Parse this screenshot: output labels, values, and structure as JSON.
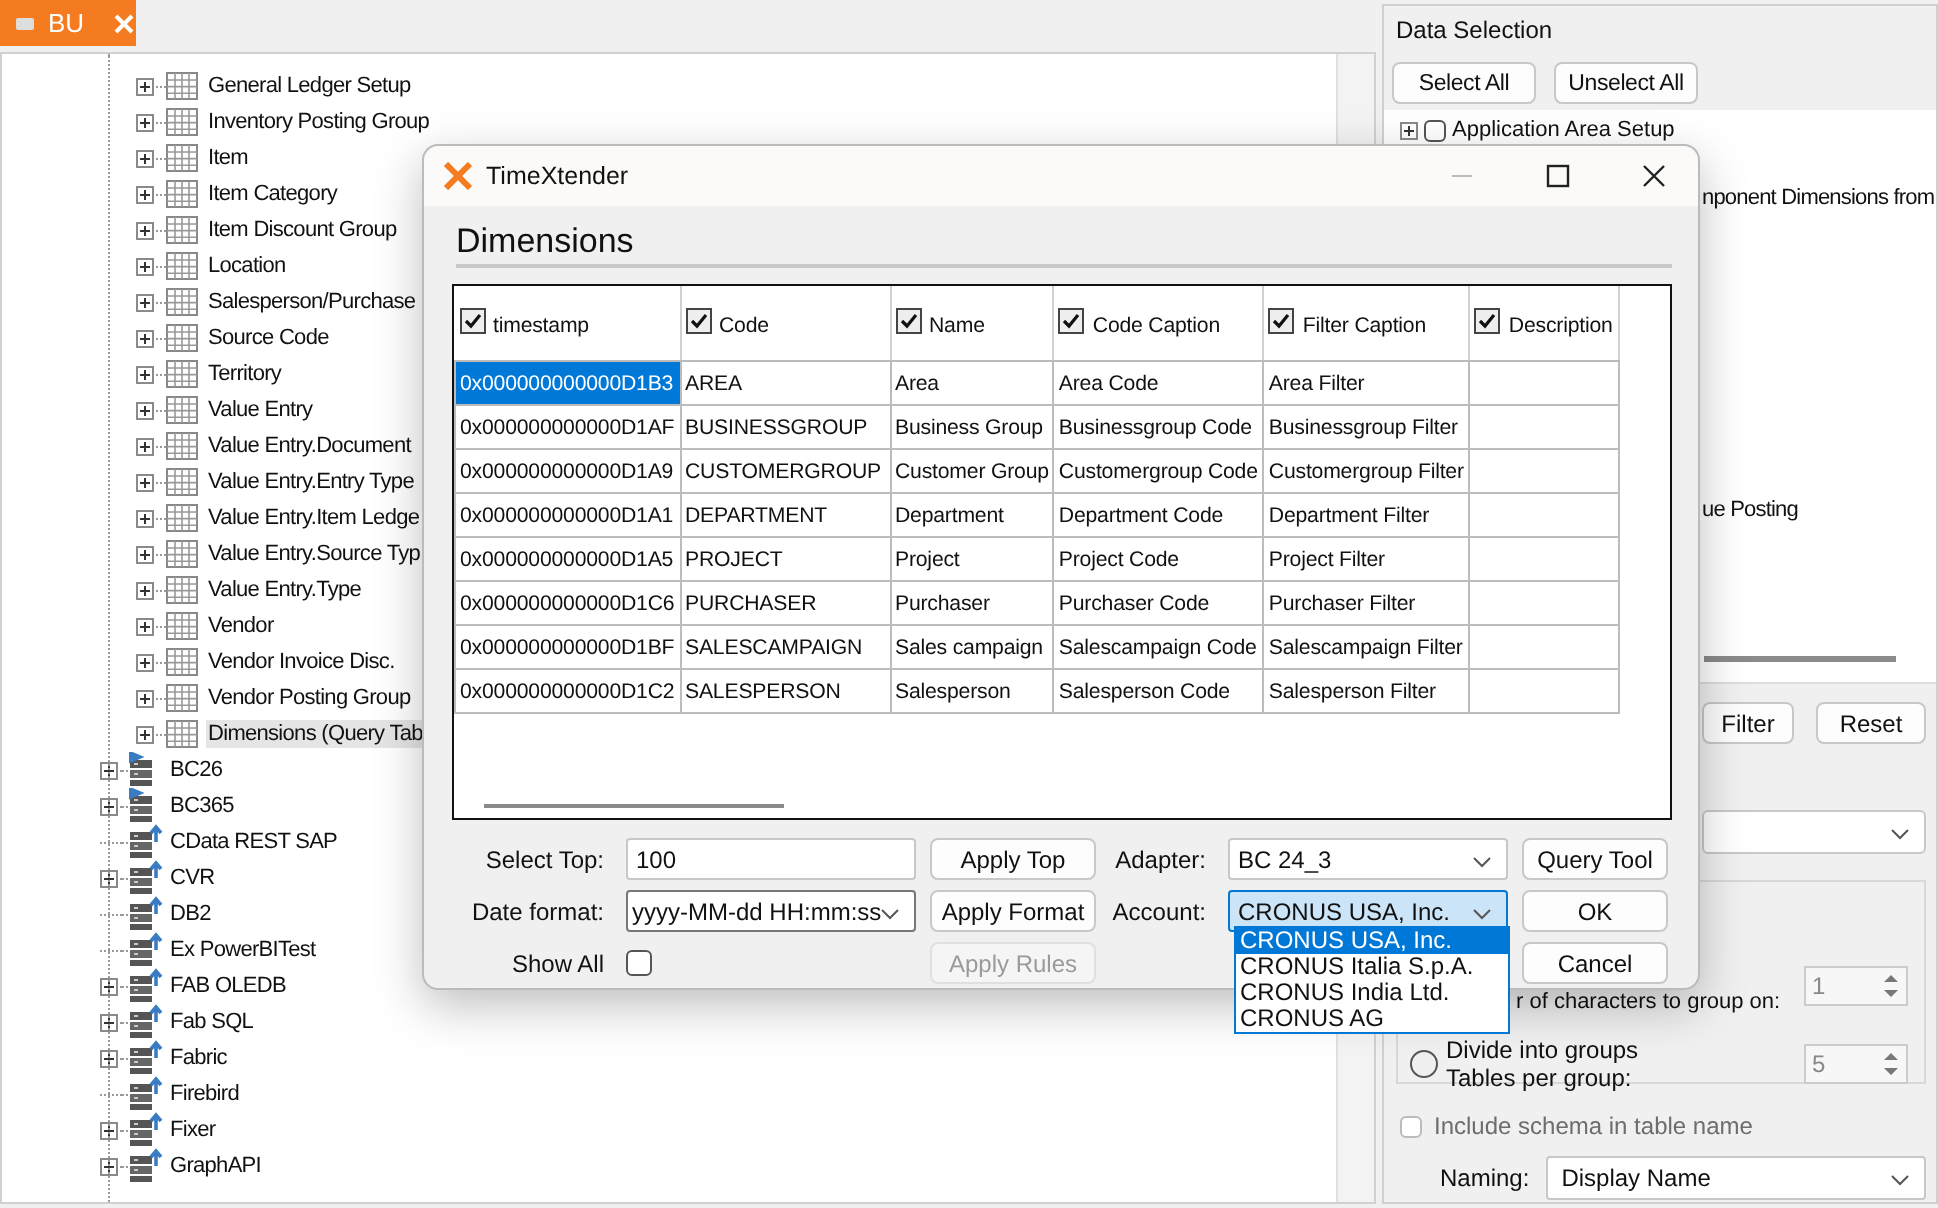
{
  "tab": {
    "label": "BU"
  },
  "tree": {
    "items": [
      {
        "children": [
          {
            "label": "General Ledger Setup",
            "selected": false
          },
          {
            "label": "Inventory Posting Group",
            "selected": false
          },
          {
            "label": "Item",
            "selected": false
          },
          {
            "label": "Item Category",
            "selected": false
          },
          {
            "label": "Item Discount Group",
            "selected": false
          },
          {
            "label": "Location",
            "selected": false
          },
          {
            "label": "Salesperson/Purchase",
            "selected": false
          },
          {
            "label": "Source Code",
            "selected": false
          },
          {
            "label": "Territory",
            "selected": false
          },
          {
            "label": "Value Entry",
            "selected": false
          },
          {
            "label": "Value Entry.Document",
            "selected": false
          },
          {
            "label": "Value Entry.Entry Type",
            "selected": false
          },
          {
            "label": "Value Entry.Item Ledge",
            "selected": false
          },
          {
            "label": "Value Entry.Source Typ",
            "selected": false
          },
          {
            "label": "Value Entry.Type",
            "selected": false
          },
          {
            "label": "Vendor",
            "selected": false
          },
          {
            "label": "Vendor Invoice Disc.",
            "selected": false
          },
          {
            "label": "Vendor Posting Group",
            "selected": false
          },
          {
            "label": "Dimensions (Query Tab",
            "selected": true
          }
        ]
      },
      {
        "label": "BC26",
        "kind": "flagged",
        "expandable": true
      },
      {
        "label": "BC365",
        "kind": "flagged",
        "expandable": true
      },
      {
        "label": "CData REST SAP",
        "kind": "source",
        "expandable": false
      },
      {
        "label": "CVR",
        "kind": "source",
        "expandable": true
      },
      {
        "label": "DB2",
        "kind": "source",
        "expandable": false
      },
      {
        "label": "Ex PowerBITest",
        "kind": "source",
        "expandable": false
      },
      {
        "label": "FAB OLEDB",
        "kind": "source",
        "expandable": true
      },
      {
        "label": "Fab SQL",
        "kind": "source",
        "expandable": true
      },
      {
        "label": "Fabric",
        "kind": "source",
        "expandable": true
      },
      {
        "label": "Firebird",
        "kind": "source",
        "expandable": false
      },
      {
        "label": "Fixer",
        "kind": "source",
        "expandable": true
      },
      {
        "label": "GraphAPI",
        "kind": "source",
        "expandable": true
      }
    ]
  },
  "data_selection": {
    "title": "Data Selection",
    "buttons": [
      "Select All",
      "Unselect All"
    ],
    "item": {
      "label": "Application Area Setup",
      "checked": false
    },
    "partial_texts": [
      "nponent Dimensions from",
      "ue Posting"
    ],
    "filter_buttons": [
      "Filter",
      "Reset"
    ],
    "group_on_text": "r of characters to group on:",
    "group_on_value": "1",
    "divide": {
      "label": "Divide into groups",
      "sublabel": "Tables per group:",
      "selected": false,
      "value": "5"
    },
    "include_schema": {
      "label": "Include schema in table name",
      "checked": false,
      "disabled": true
    },
    "naming": {
      "label": "Naming:",
      "value": "Display Name"
    }
  },
  "dialog": {
    "title": "TimeXtender",
    "heading": "Dimensions",
    "columns": [
      {
        "label": "timestamp",
        "checked": true
      },
      {
        "label": "Code",
        "checked": true
      },
      {
        "label": "Name",
        "checked": true
      },
      {
        "label": "Code Caption",
        "checked": true
      },
      {
        "label": "Filter Caption",
        "checked": true
      },
      {
        "label": "Description",
        "checked": true
      }
    ],
    "rows": [
      {
        "selected": true,
        "cells": [
          "0x000000000000D1B3",
          "AREA",
          "Area",
          "Area Code",
          "Area Filter",
          ""
        ]
      },
      {
        "selected": false,
        "cells": [
          "0x000000000000D1AF",
          "BUSINESSGROUP",
          "Business Group",
          "Businessgroup Code",
          "Businessgroup Filter",
          ""
        ]
      },
      {
        "selected": false,
        "cells": [
          "0x000000000000D1A9",
          "CUSTOMERGROUP",
          "Customer Group",
          "Customergroup Code",
          "Customergroup Filter",
          ""
        ]
      },
      {
        "selected": false,
        "cells": [
          "0x000000000000D1A1",
          "DEPARTMENT",
          "Department",
          "Department Code",
          "Department Filter",
          ""
        ]
      },
      {
        "selected": false,
        "cells": [
          "0x000000000000D1A5",
          "PROJECT",
          "Project",
          "Project Code",
          "Project Filter",
          ""
        ]
      },
      {
        "selected": false,
        "cells": [
          "0x000000000000D1C6",
          "PURCHASER",
          "Purchaser",
          "Purchaser Code",
          "Purchaser Filter",
          ""
        ]
      },
      {
        "selected": false,
        "cells": [
          "0x000000000000D1BF",
          "SALESCAMPAIGN",
          "Sales campaign",
          "Salescampaign Code",
          "Salescampaign Filter",
          ""
        ]
      },
      {
        "selected": false,
        "cells": [
          "0x000000000000D1C2",
          "SALESPERSON",
          "Salesperson",
          "Salesperson Code",
          "Salesperson Filter",
          ""
        ]
      }
    ],
    "select_top": {
      "label": "Select Top:",
      "value": "100",
      "button": "Apply Top"
    },
    "date_format": {
      "label": "Date format:",
      "value": "yyyy-MM-dd HH:mm:ss",
      "button": "Apply Format"
    },
    "show_all": {
      "label": "Show All",
      "checked": false,
      "button": "Apply Rules",
      "button_disabled": true
    },
    "adapter": {
      "label": "Adapter:",
      "value": "BC 24_3",
      "button": "Query Tool"
    },
    "account": {
      "label": "Account:",
      "value": "CRONUS USA, Inc.",
      "open": true,
      "button": "OK",
      "options": [
        {
          "label": "CRONUS USA, Inc.",
          "selected": true
        },
        {
          "label": "CRONUS Italia S.p.A.",
          "selected": false
        },
        {
          "label": "CRONUS India Ltd.",
          "selected": false
        },
        {
          "label": "CRONUS AG",
          "selected": false
        }
      ]
    },
    "cancel": "Cancel"
  }
}
